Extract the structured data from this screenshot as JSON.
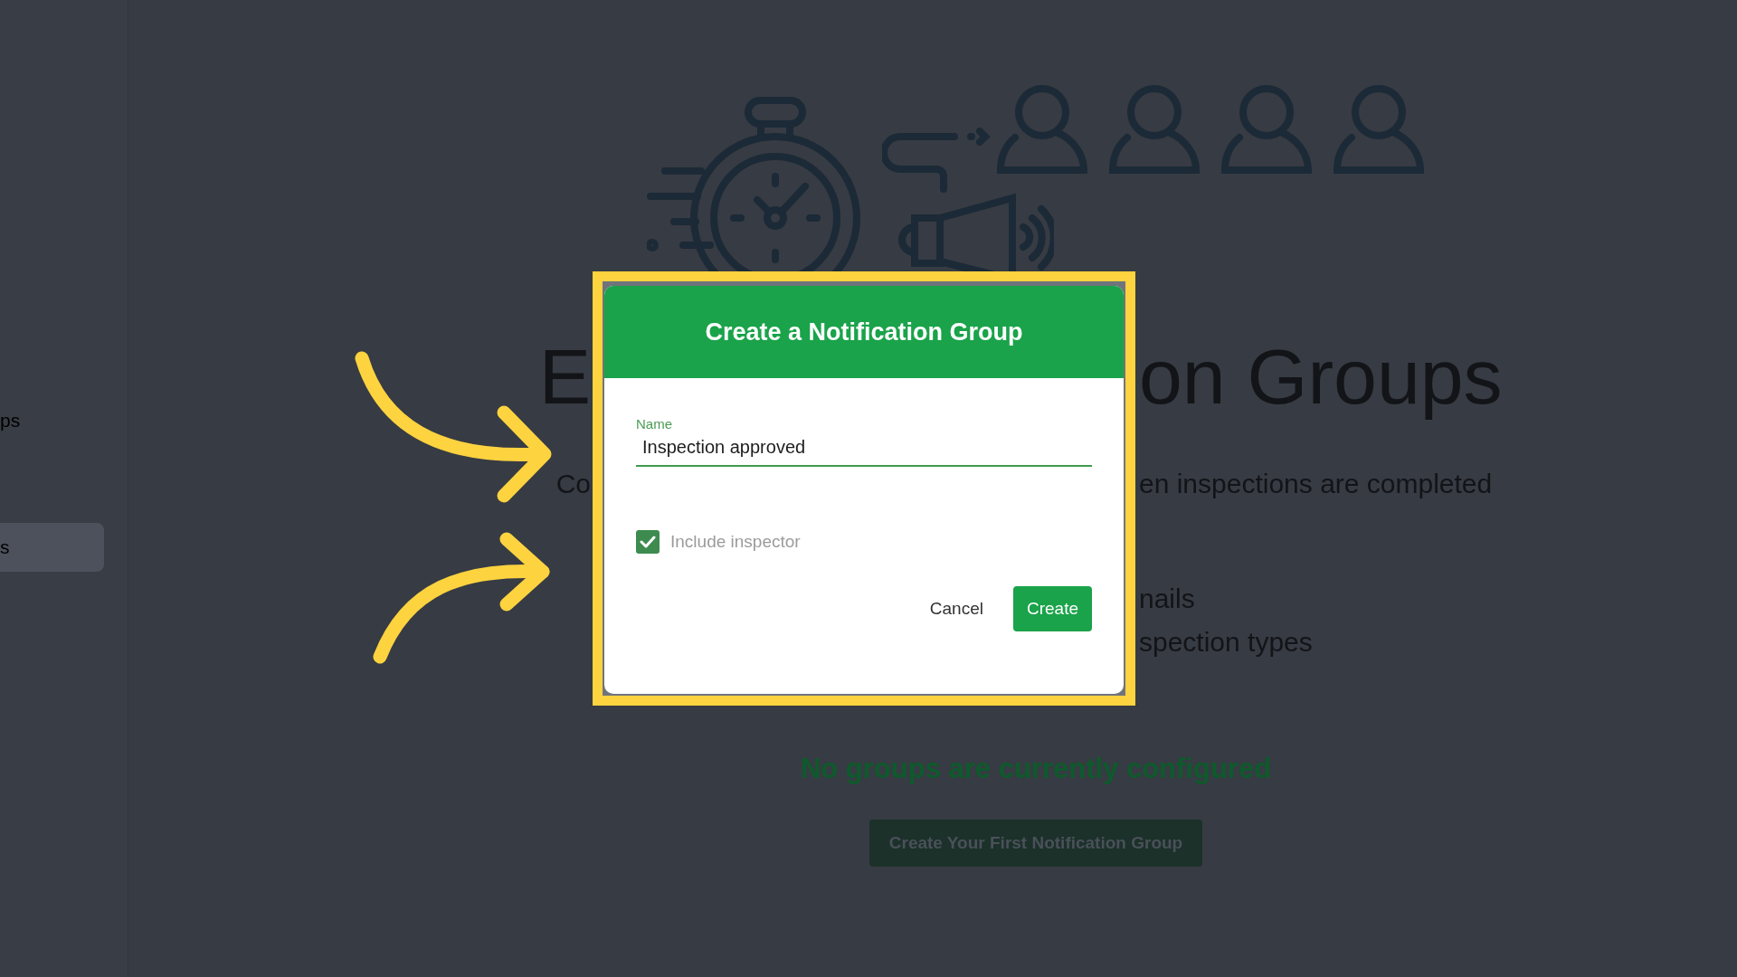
{
  "sidebar": {
    "items": [
      {
        "label": "ps",
        "selected": false
      },
      {
        "label": "s",
        "selected": true
      }
    ]
  },
  "page": {
    "heading_left": "E",
    "heading_right": "on Groups",
    "subtitle_left": "Co",
    "subtitle_right": "en inspections are completed",
    "features": [
      "nails",
      "spection types"
    ],
    "empty_message": "No groups are currently configured",
    "create_first_button": "Create Your First Notification Group"
  },
  "dialog": {
    "title": "Create a Notification Group",
    "name_field": {
      "label": "Name",
      "value": "Inspection approved"
    },
    "include_inspector": {
      "label": "Include inspector",
      "checked": true
    },
    "buttons": [
      {
        "label": "Cancel",
        "kind": "text"
      },
      {
        "label": "Create",
        "kind": "primary"
      }
    ]
  }
}
